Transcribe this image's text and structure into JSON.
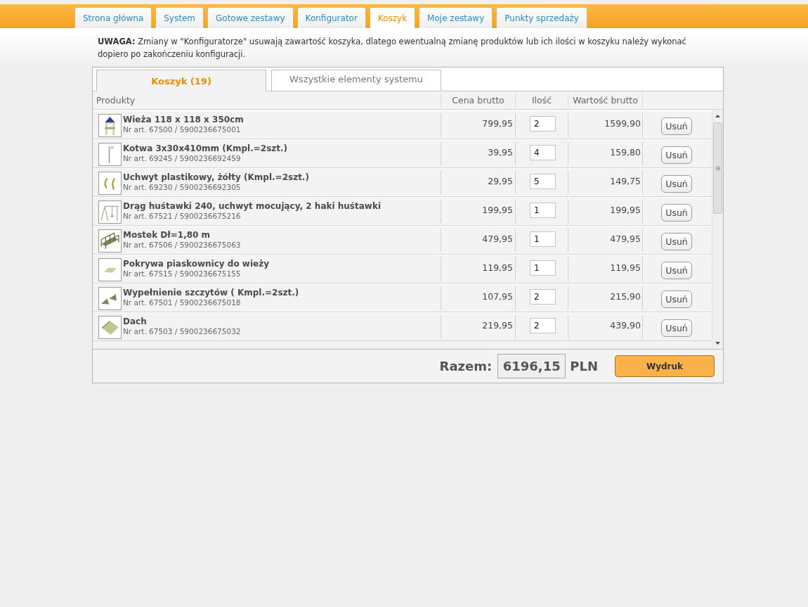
{
  "nav_tabs": [
    {
      "label": "Strona główna",
      "selected": false
    },
    {
      "label": "System",
      "selected": false
    },
    {
      "label": "Gotowe zestawy",
      "selected": false
    },
    {
      "label": "Konfigurator",
      "selected": false
    },
    {
      "label": "Koszyk",
      "selected": true
    },
    {
      "label": "Moje zestawy",
      "selected": false
    },
    {
      "label": "Punkty sprzedaży",
      "selected": false
    }
  ],
  "notice": "**UWAGA:** Zmiany w \"Konfiguratorze\" usuwają zawartość koszyka, dlatego ewentualną zmianę produktów lub ich ilości w koszyku należy wykonać dopiero po zakończeniu konfiguracji.",
  "cart_tabs": [
    {
      "label": "Koszyk (19)",
      "selected": true
    },
    {
      "label": "Wszystkie elementy systemu",
      "selected": false
    }
  ],
  "table": {
    "columns": [
      "Produkty",
      "Cena brutto",
      "Ilość",
      "Wartość brutto"
    ],
    "rows": [
      {
        "kind": "tower",
        "name": "Wieża 118 x 118 x 350cm",
        "article": "Nr art. 67500 / 5900236675001",
        "price": "799,95",
        "quantity": "2",
        "total": "1599,90",
        "action": "Usuń"
      },
      {
        "kind": "post",
        "name": "Kotwa 3x30x410mm (Kmpl.=2szt.)",
        "article": "Nr art. 69245 / 5900236692459",
        "price": "39,95",
        "quantity": "4",
        "total": "159,80",
        "action": "Usuń"
      },
      {
        "kind": "handles",
        "name": "Uchwyt plastikowy, żółty (Kmpl.=2szt.)",
        "article": "Nr art. 69230 / 5900236692305",
        "price": "29,95",
        "quantity": "5",
        "total": "149,75",
        "action": "Usuń"
      },
      {
        "kind": "swing",
        "name": "Drąg huśtawki 240, uchwyt mocujący, 2 haki huśtawki",
        "article": "Nr art. 67521 / 5900236675216",
        "price": "199,95",
        "quantity": "1",
        "total": "199,95",
        "action": "Usuń"
      },
      {
        "kind": "bridge",
        "name": "Mostek Dł=1,80 m",
        "article": "Nr art. 67506 / 5900236675063",
        "price": "479,95",
        "quantity": "1",
        "total": "479,95",
        "action": "Usuń"
      },
      {
        "kind": "cover",
        "name": "Pokrywa piaskownicy do wieży",
        "article": "Nr art. 67515 / 5900236675155",
        "price": "119,95",
        "quantity": "1",
        "total": "119,95",
        "action": "Usuń"
      },
      {
        "kind": "gables",
        "name": "Wypełnienie szczytów ( Kmpl.=2szt.)",
        "article": "Nr art. 67501 / 5900236675018",
        "price": "107,95",
        "quantity": "2",
        "total": "215,90",
        "action": "Usuń"
      },
      {
        "kind": "roof",
        "name": "Dach",
        "article": "Nr art. 67503 / 5900236675032",
        "price": "219,95",
        "quantity": "2",
        "total": "439,90",
        "action": "Usuń"
      }
    ]
  },
  "summary": {
    "label": "Razem:",
    "total": "6196,15",
    "currency": "PLN",
    "button": "Wydruk"
  }
}
